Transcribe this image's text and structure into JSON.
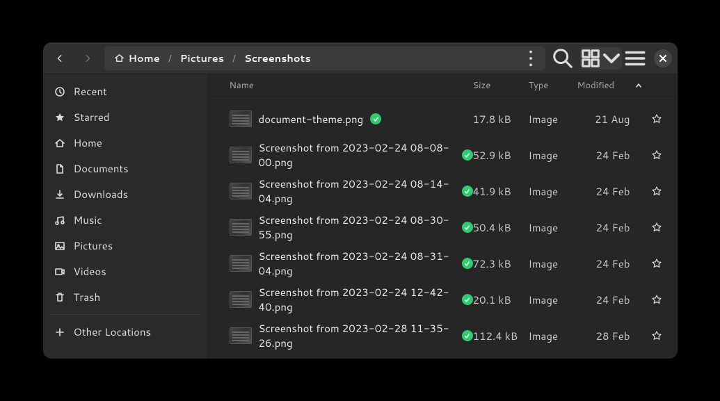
{
  "breadcrumb": {
    "home": "Home",
    "pictures": "Pictures",
    "screenshots": "Screenshots"
  },
  "sidebar": {
    "items": [
      {
        "label": "Recent"
      },
      {
        "label": "Starred"
      },
      {
        "label": "Home"
      },
      {
        "label": "Documents"
      },
      {
        "label": "Downloads"
      },
      {
        "label": "Music"
      },
      {
        "label": "Pictures"
      },
      {
        "label": "Videos"
      },
      {
        "label": "Trash"
      }
    ],
    "other_locations": "Other Locations"
  },
  "columns": {
    "name": "Name",
    "size": "Size",
    "type": "Type",
    "modified": "Modified"
  },
  "files": [
    {
      "name": "document-theme.png",
      "size": "17.8 kB",
      "type": "Image",
      "modified": "21 Aug",
      "starred": true
    },
    {
      "name": "Screenshot from 2023-02-24 08-08-00.png",
      "size": "52.9 kB",
      "type": "Image",
      "modified": "24 Feb",
      "starred": false
    },
    {
      "name": "Screenshot from 2023-02-24 08-14-04.png",
      "size": "41.9 kB",
      "type": "Image",
      "modified": "24 Feb",
      "starred": false
    },
    {
      "name": "Screenshot from 2023-02-24 08-30-55.png",
      "size": "50.4 kB",
      "type": "Image",
      "modified": "24 Feb",
      "starred": false
    },
    {
      "name": "Screenshot from 2023-02-24 08-31-04.png",
      "size": "72.3 kB",
      "type": "Image",
      "modified": "24 Feb",
      "starred": false
    },
    {
      "name": "Screenshot from 2023-02-24 12-42-40.png",
      "size": "20.1 kB",
      "type": "Image",
      "modified": "24 Feb",
      "starred": false
    },
    {
      "name": "Screenshot from 2023-02-28 11-35-26.png",
      "size": "112.4 kB",
      "type": "Image",
      "modified": "28 Feb",
      "starred": false
    }
  ]
}
